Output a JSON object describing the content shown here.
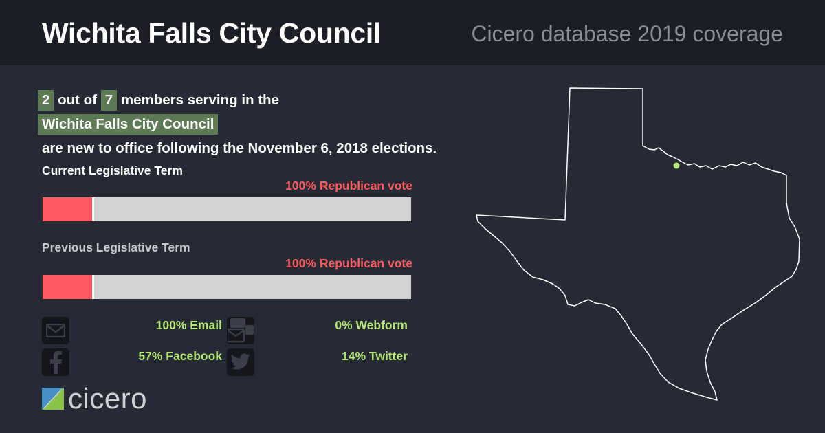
{
  "header": {
    "title": "Wichita Falls City Council",
    "subtitle": "Cicero database 2019 coverage"
  },
  "summary": {
    "new_count": "2",
    "out_of": "out of",
    "total_count": "7",
    "members_text": "members serving in the",
    "body_name": "Wichita Falls City Council",
    "closing_text": "are new to office following the November 6, 2018 elections."
  },
  "current_term": {
    "label": "Current Legislative Term",
    "vote_label": "100% Republican vote",
    "republican_fraction": 0.14,
    "label_color": "#ffffff"
  },
  "previous_term": {
    "label": "Previous Legislative Term",
    "vote_label": "100% Republican vote",
    "republican_fraction": 0.14,
    "label_color": "#c8c9cc"
  },
  "contact": {
    "email": "100% Email",
    "webform": "0% Webform",
    "facebook": "57% Facebook",
    "twitter": "14% Twitter"
  },
  "logo": {
    "text": "cicero"
  },
  "map": {
    "icon": "texas-map",
    "marker": "wichita-falls-location"
  },
  "colors": {
    "republican": "#ff5a5f",
    "highlight": "#5e7a54",
    "contact_text": "#b6e878",
    "background": "#262a35",
    "header_bg": "#1b1e25"
  }
}
